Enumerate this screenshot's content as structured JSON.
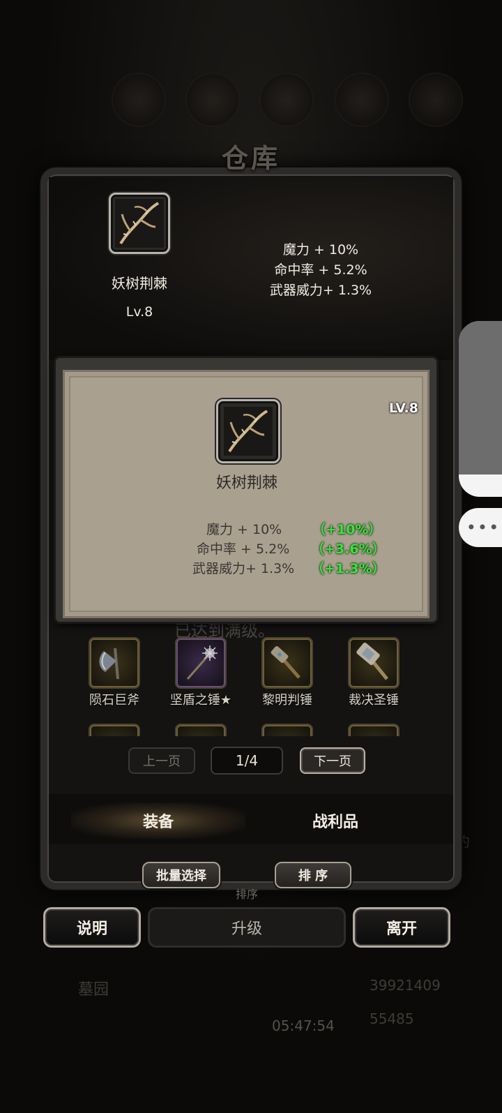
{
  "window": {
    "title": "仓库"
  },
  "selected_item": {
    "name": "妖树荆棘",
    "level": "Lv.8",
    "stats": [
      "魔力 + 10%",
      "命中率 + 5.2%",
      "武器威力+ 1.3%"
    ]
  },
  "tooltip": {
    "level": "LV.8",
    "name": "妖树荆棘",
    "stats": [
      {
        "label": "魔力 + 10%",
        "bonus": "（+10%）"
      },
      {
        "label": "命中率 + 5.2%",
        "bonus": "（+3.6%）"
      },
      {
        "label": "武器威力+ 1.3%",
        "bonus": "（+1.3%）"
      }
    ]
  },
  "maxed_note": "已达到满级。",
  "grid": {
    "items": [
      {
        "name": "陨石巨斧",
        "icon": "axe-icon"
      },
      {
        "name": "坚盾之锤★",
        "icon": "mace-icon"
      },
      {
        "name": "黎明判锤",
        "icon": "hammer-icon"
      },
      {
        "name": "裁决圣锤",
        "icon": "warhammer-icon"
      }
    ]
  },
  "pagination": {
    "prev": "上一页",
    "current": "1/4",
    "next": "下一页"
  },
  "tabs": {
    "equipment": "装备",
    "loot": "战利品"
  },
  "actions": {
    "batch_select": "批量选择",
    "sort": "排 序",
    "sort_ghost": "排序"
  },
  "bottom_buttons": {
    "help": "说明",
    "upgrade": "升级",
    "leave": "离开"
  },
  "background": {
    "clock": "05:47:54",
    "corner_label": "约",
    "gold": "39921409",
    "gems": "55485",
    "garden": "墓园"
  },
  "colors": {
    "bonus_green": "#40e03e",
    "panel_beige": "#aaa090"
  }
}
